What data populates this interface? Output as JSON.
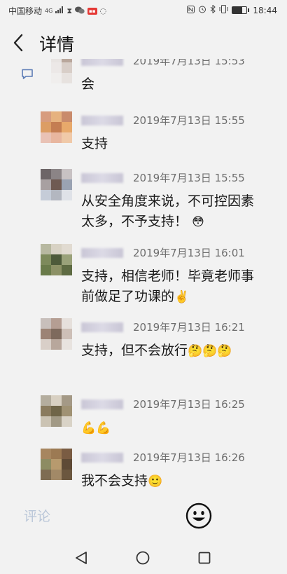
{
  "status_bar": {
    "carrier": "中国移动",
    "network": "4G",
    "time": "18:44",
    "battery_level": 0.7,
    "icons": [
      "signal-icon",
      "hourglass-icon",
      "wechat-icon",
      "app-badge-icon",
      "nfc-icon",
      "alarm-icon",
      "bluetooth-icon",
      "vibrate-icon",
      "battery-icon"
    ]
  },
  "header": {
    "title": "详情",
    "back_icon": "chevron-left-icon"
  },
  "comments": [
    {
      "time": "2019年7月13日 15:53",
      "text": "会"
    },
    {
      "time": "2019年7月13日 15:55",
      "text": "支持"
    },
    {
      "time": "2019年7月13日 15:55",
      "text": "从安全角度来说，不可控因素太多，不予支持！",
      "emoji": "😳"
    },
    {
      "time": "2019年7月13日 16:01",
      "text": "支持，相信老师！毕竟老师事前做足了功课的",
      "emoji": "✌️"
    },
    {
      "time": "2019年7月13日 16:21",
      "text": "支持，但不会放行",
      "emoji": "🤔🤔🤔"
    },
    {
      "time": "2019年7月13日 16:25",
      "text": "",
      "emoji": "💪💪"
    },
    {
      "time": "2019年7月13日 16:26",
      "text": "我不会支持",
      "emoji": "🙂"
    }
  ],
  "bottom_bar": {
    "comment_placeholder": "评论",
    "emoji_icon": "smiley-icon"
  },
  "nav_bar": {
    "icons": [
      "nav-back-icon",
      "nav-home-icon",
      "nav-recent-icon"
    ]
  },
  "colors": {
    "background": "#f2f2f2",
    "time_text": "#6d6d6d",
    "placeholder": "#b9c6d8"
  }
}
